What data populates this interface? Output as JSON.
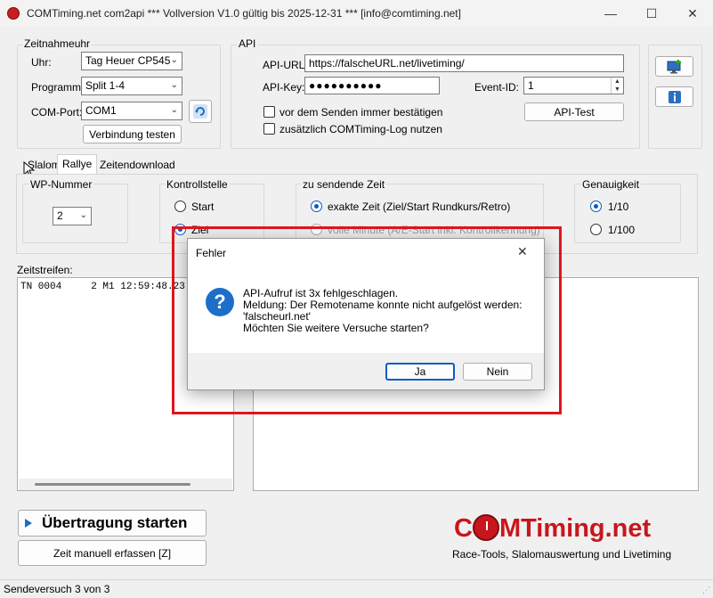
{
  "window": {
    "title": "COMTiming.net com2api *** Vollversion V1.0 gültig bis 2025-12-31 *** [info@comtiming.net]",
    "minimize": "—",
    "maximize": "☐",
    "close": "✕"
  },
  "zeitnahmeuhr": {
    "group_label": "Zeitnahmeuhr",
    "uhr_label": "Uhr:",
    "uhr_value": "Tag Heuer CP545",
    "programm_label": "Programm:",
    "programm_value": "Split 1-4",
    "comport_label": "COM-Port:",
    "comport_value": "COM1",
    "test_button": "Verbindung testen"
  },
  "api": {
    "group_label": "API",
    "url_label": "API-URL:",
    "url_value": "https://falscheURL.net/livetiming/",
    "key_label": "API-Key:",
    "key_value": "●●●●●●●●●●",
    "event_label": "Event-ID:",
    "event_value": "1",
    "confirm_label": "vor dem Senden immer bestätigen",
    "log_label": "zusätzlich COMTiming-Log nutzen",
    "test_button": "API-Test"
  },
  "tabs": [
    "Slalom",
    "Rallye",
    "Zeitendownload"
  ],
  "rallye": {
    "wp_label": "WP-Nummer",
    "wp_value": "2",
    "kontroll_label": "Kontrollstelle",
    "kontroll_options": [
      "Start",
      "Ziel"
    ],
    "zeit_label": "zu sendende Zeit",
    "zeit_options": [
      "exakte Zeit (Ziel/Start Rundkurs/Retro)",
      "volle Minute (A/E-Start inkl. Kontrollkennung)"
    ],
    "genau_label": "Genauigkeit",
    "genau_options": [
      "1/10",
      "1/100"
    ]
  },
  "zeitstreifen": {
    "label": "Zeitstreifen:",
    "line": "TN 0004     2 M1 12:59:48.23"
  },
  "dialog": {
    "title": "Fehler",
    "close": "✕",
    "icon": "?",
    "message_lines": [
      "API-Aufruf ist 3x fehlgeschlagen.",
      "Meldung: Der Remotename konnte nicht aufgelöst werden:",
      "'falscheurl.net'",
      "Möchten Sie weitere Versuche starten?"
    ],
    "yes": "Ja",
    "no": "Nein"
  },
  "actions": {
    "start_button": "Übertragung starten",
    "manual_button": "Zeit manuell erfassen [Z]"
  },
  "brand": {
    "logo_c": "C",
    "logo_m": "MTiming.net",
    "tagline": "Race-Tools, Slalomauswertung und Livetiming",
    "color_red": "#c8161d",
    "color_blue": "#1f4e9c"
  },
  "status": {
    "text": "Sendeversuch 3 von 3"
  },
  "icons": {
    "refresh": "refresh-icon",
    "monitor": "monitor-icon",
    "info": "info-icon",
    "question": "question-icon",
    "play": "play-icon"
  }
}
